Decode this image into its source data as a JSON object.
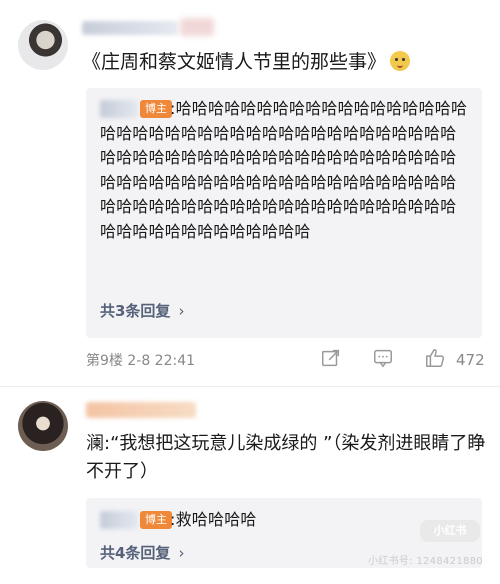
{
  "comment1": {
    "text": "《庄周和蔡文姬情人节里的那些事》",
    "emoji": "dog-emoji",
    "reply": {
      "badge": "博主",
      "text": ":哈哈哈哈哈哈哈哈哈哈哈哈哈哈哈哈哈哈哈哈哈哈哈哈哈哈哈哈哈哈哈哈哈哈哈哈哈哈哈哈哈哈哈哈哈哈哈哈哈哈哈哈哈哈哈哈哈哈哈哈哈哈哈哈哈哈哈哈哈哈哈哈哈哈哈哈哈哈哈哈哈哈哈哈哈哈哈哈哈哈哈哈哈哈哈哈哈哈哈哈哈哈哈哈哈哈哈哈哈哈哈哈哈哈哈哈哈哈哈",
      "more": "共3条回复"
    },
    "floor_time": "第9楼  2-8 22:41",
    "likes": "472"
  },
  "comment2": {
    "text": "澜:“我想把这玩意儿染成绿的 ”（染发剂进眼睛了睁不开了）",
    "reply": {
      "badge": "博主",
      "text": ":救哈哈哈哈",
      "more": "共4条回复"
    }
  },
  "watermark": {
    "logo": "小红书",
    "id": "小红书号: 1248421880"
  },
  "colors": {
    "badge": "#f0883a",
    "link": "#56617a",
    "reply_bg": "#f3f3f5"
  }
}
